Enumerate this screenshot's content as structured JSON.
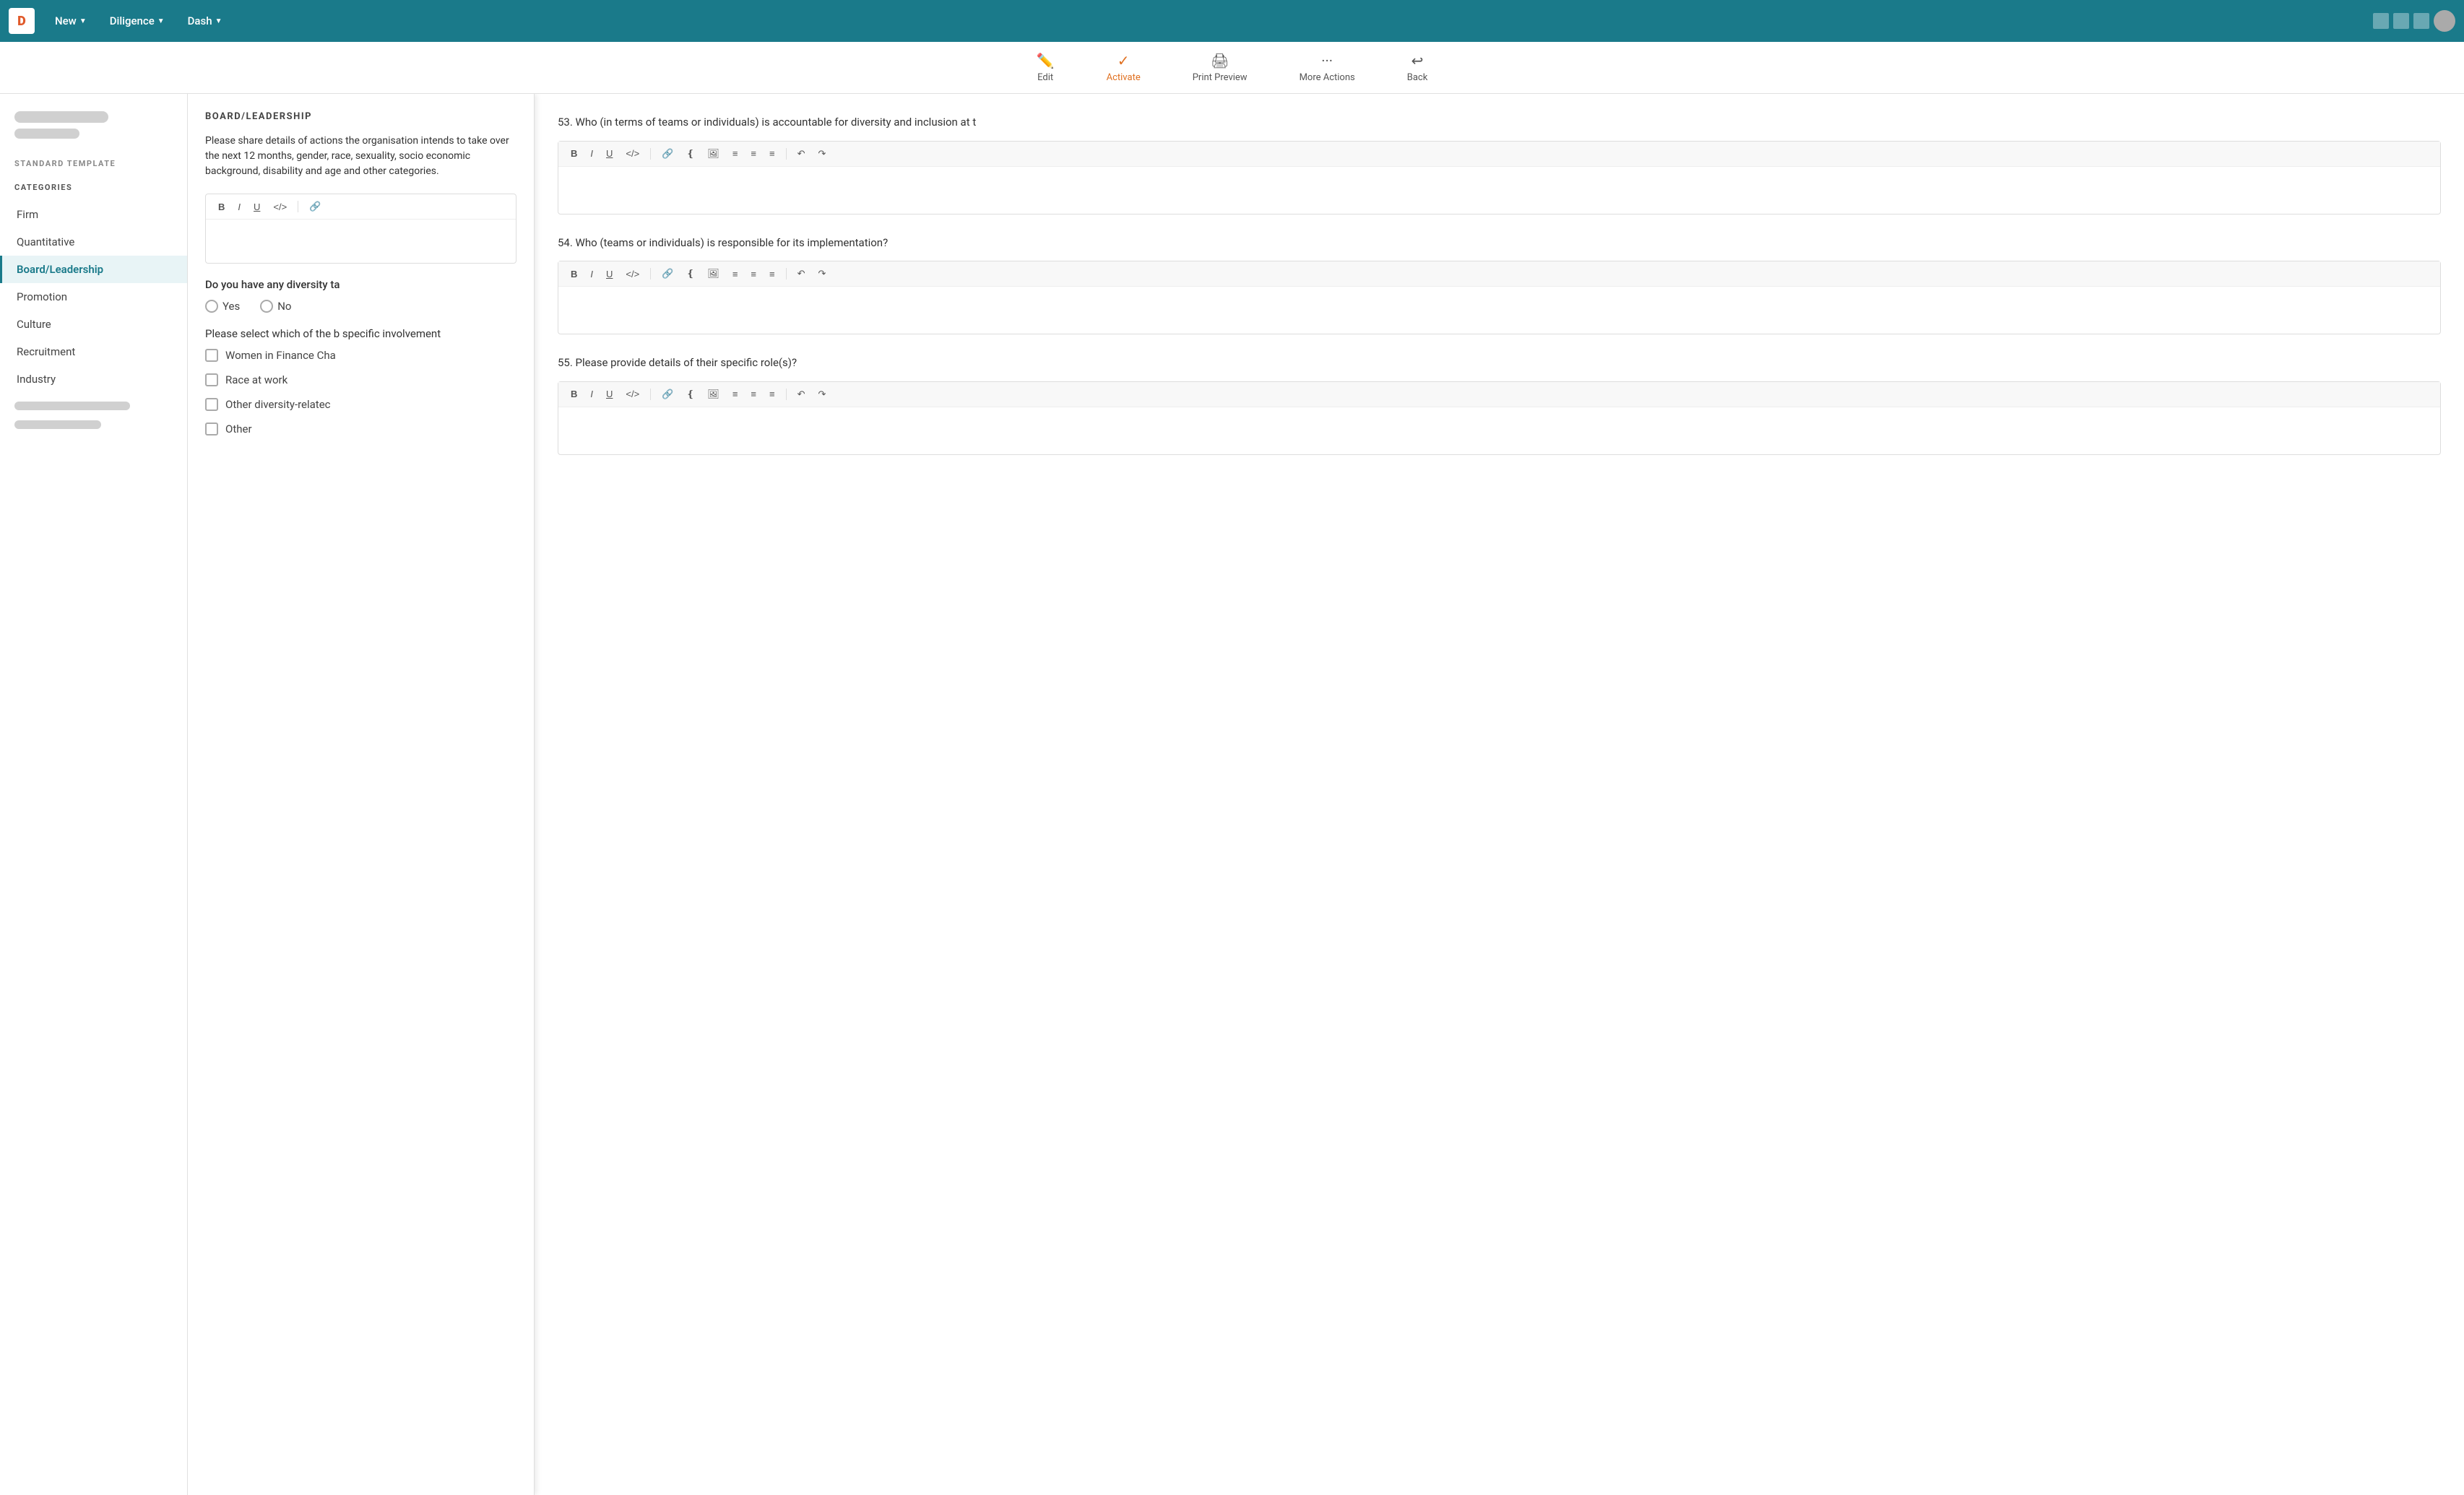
{
  "topnav": {
    "items": [
      {
        "id": "new",
        "label": "New",
        "has_dropdown": true
      },
      {
        "id": "diligence",
        "label": "Diligence",
        "has_dropdown": true
      },
      {
        "id": "dash",
        "label": "Dash",
        "has_dropdown": true
      }
    ]
  },
  "toolbar": {
    "edit_label": "Edit",
    "activate_label": "Activate",
    "print_preview_label": "Print Preview",
    "more_actions_label": "More Actions",
    "back_label": "Back"
  },
  "sidebar": {
    "standard_template_label": "STANDARD TEMPLATE",
    "categories_label": "CATEGORIES",
    "items": [
      {
        "id": "firm",
        "label": "Firm",
        "active": false
      },
      {
        "id": "quantitative",
        "label": "Quantitative",
        "active": false
      },
      {
        "id": "board-leadership",
        "label": "Board/Leadership",
        "active": true
      },
      {
        "id": "promotion",
        "label": "Promotion",
        "active": false
      },
      {
        "id": "culture",
        "label": "Culture",
        "active": false
      },
      {
        "id": "recruitment",
        "label": "Recruitment",
        "active": false
      },
      {
        "id": "industry",
        "label": "Industry",
        "active": false
      }
    ]
  },
  "left_panel": {
    "section_title": "BOARD/LEADERSHIP",
    "description": "Please share details of actions the organisation intends to take over the next 12 months, gender, race, sexuality, socio economic background, disability and age and other categories.",
    "diversity_question": "Do you have any diversity ta",
    "yes_label": "Yes",
    "no_label": "No",
    "select_text": "Please select which of the b specific involvement",
    "checkboxes": [
      {
        "id": "women-finance",
        "label": "Women in Finance Cha"
      },
      {
        "id": "race-at-work",
        "label": "Race at work"
      },
      {
        "id": "other-diversity",
        "label": "Other diversity-relatec"
      },
      {
        "id": "other",
        "label": "Other"
      }
    ]
  },
  "right_panel": {
    "questions": [
      {
        "id": 53,
        "text": "53. Who (in terms of teams or individuals) is accountable for diversity and inclusion at t"
      },
      {
        "id": 54,
        "text": "54. Who (teams or individuals) is responsible for its implementation?"
      },
      {
        "id": 55,
        "text": "55. Please provide details of their specific role(s)?"
      }
    ]
  },
  "editor_buttons": {
    "bold": "B",
    "italic": "I",
    "underline": "U",
    "code": "</>",
    "link": "🔗",
    "quote": "❝",
    "image": "🖼",
    "align_left": "≡",
    "align_center": "≡",
    "list": "≡",
    "undo": "↶",
    "redo": "↷"
  }
}
